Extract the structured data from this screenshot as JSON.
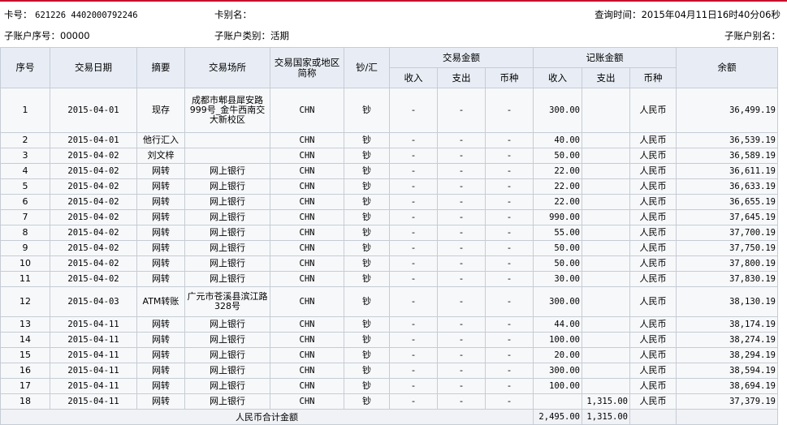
{
  "header": {
    "card_no_label": "卡号：",
    "card_no": "621226 4402000792246",
    "card_alias_label": "卡别名：",
    "query_time_label": "查询时间：",
    "query_time": "2015年04月11日16时40分06秒",
    "sub_seq_label": "子账户序号：",
    "sub_seq": "00000",
    "sub_type_label": "子账户类别：",
    "sub_type": "活期",
    "sub_alias_label": "子账户别名："
  },
  "table": {
    "headers": {
      "seq": "序号",
      "date": "交易日期",
      "summary": "摘要",
      "place": "交易场所",
      "country": "交易国家或地区简称",
      "cash": "钞/汇",
      "trans_amount": "交易金额",
      "book_amount": "记账金额",
      "balance": "余额",
      "income": "收入",
      "expense": "支出",
      "currency": "币种"
    },
    "rows": [
      {
        "seq": "1",
        "date": "2015-04-01",
        "summary": "现存",
        "place": "成都市郫县犀安路999号_金牛西南交大新校区",
        "country": "CHN",
        "cash": "钞",
        "t_in": "-",
        "t_out": "-",
        "t_cur": "-",
        "b_in": "300.00",
        "b_out": "",
        "b_cur": "人民币",
        "balance": "36,499.19"
      },
      {
        "seq": "2",
        "date": "2015-04-01",
        "summary": "他行汇入",
        "place": "",
        "country": "CHN",
        "cash": "钞",
        "t_in": "-",
        "t_out": "-",
        "t_cur": "-",
        "b_in": "40.00",
        "b_out": "",
        "b_cur": "人民币",
        "balance": "36,539.19"
      },
      {
        "seq": "3",
        "date": "2015-04-02",
        "summary": "刘文梓",
        "place": "",
        "country": "CHN",
        "cash": "钞",
        "t_in": "-",
        "t_out": "-",
        "t_cur": "-",
        "b_in": "50.00",
        "b_out": "",
        "b_cur": "人民币",
        "balance": "36,589.19"
      },
      {
        "seq": "4",
        "date": "2015-04-02",
        "summary": "网转",
        "place": "网上银行",
        "country": "CHN",
        "cash": "钞",
        "t_in": "-",
        "t_out": "-",
        "t_cur": "-",
        "b_in": "22.00",
        "b_out": "",
        "b_cur": "人民币",
        "balance": "36,611.19"
      },
      {
        "seq": "5",
        "date": "2015-04-02",
        "summary": "网转",
        "place": "网上银行",
        "country": "CHN",
        "cash": "钞",
        "t_in": "-",
        "t_out": "-",
        "t_cur": "-",
        "b_in": "22.00",
        "b_out": "",
        "b_cur": "人民币",
        "balance": "36,633.19"
      },
      {
        "seq": "6",
        "date": "2015-04-02",
        "summary": "网转",
        "place": "网上银行",
        "country": "CHN",
        "cash": "钞",
        "t_in": "-",
        "t_out": "-",
        "t_cur": "-",
        "b_in": "22.00",
        "b_out": "",
        "b_cur": "人民币",
        "balance": "36,655.19"
      },
      {
        "seq": "7",
        "date": "2015-04-02",
        "summary": "网转",
        "place": "网上银行",
        "country": "CHN",
        "cash": "钞",
        "t_in": "-",
        "t_out": "-",
        "t_cur": "-",
        "b_in": "990.00",
        "b_out": "",
        "b_cur": "人民币",
        "balance": "37,645.19"
      },
      {
        "seq": "8",
        "date": "2015-04-02",
        "summary": "网转",
        "place": "网上银行",
        "country": "CHN",
        "cash": "钞",
        "t_in": "-",
        "t_out": "-",
        "t_cur": "-",
        "b_in": "55.00",
        "b_out": "",
        "b_cur": "人民币",
        "balance": "37,700.19"
      },
      {
        "seq": "9",
        "date": "2015-04-02",
        "summary": "网转",
        "place": "网上银行",
        "country": "CHN",
        "cash": "钞",
        "t_in": "-",
        "t_out": "-",
        "t_cur": "-",
        "b_in": "50.00",
        "b_out": "",
        "b_cur": "人民币",
        "balance": "37,750.19"
      },
      {
        "seq": "10",
        "date": "2015-04-02",
        "summary": "网转",
        "place": "网上银行",
        "country": "CHN",
        "cash": "钞",
        "t_in": "-",
        "t_out": "-",
        "t_cur": "-",
        "b_in": "50.00",
        "b_out": "",
        "b_cur": "人民币",
        "balance": "37,800.19"
      },
      {
        "seq": "11",
        "date": "2015-04-02",
        "summary": "网转",
        "place": "网上银行",
        "country": "CHN",
        "cash": "钞",
        "t_in": "-",
        "t_out": "-",
        "t_cur": "-",
        "b_in": "30.00",
        "b_out": "",
        "b_cur": "人民币",
        "balance": "37,830.19"
      },
      {
        "seq": "12",
        "date": "2015-04-03",
        "summary": "ATM转账",
        "place": "广元市苍溪县滨江路328号",
        "country": "CHN",
        "cash": "钞",
        "t_in": "-",
        "t_out": "-",
        "t_cur": "-",
        "b_in": "300.00",
        "b_out": "",
        "b_cur": "人民币",
        "balance": "38,130.19"
      },
      {
        "seq": "13",
        "date": "2015-04-11",
        "summary": "网转",
        "place": "网上银行",
        "country": "CHN",
        "cash": "钞",
        "t_in": "-",
        "t_out": "-",
        "t_cur": "-",
        "b_in": "44.00",
        "b_out": "",
        "b_cur": "人民币",
        "balance": "38,174.19"
      },
      {
        "seq": "14",
        "date": "2015-04-11",
        "summary": "网转",
        "place": "网上银行",
        "country": "CHN",
        "cash": "钞",
        "t_in": "-",
        "t_out": "-",
        "t_cur": "-",
        "b_in": "100.00",
        "b_out": "",
        "b_cur": "人民币",
        "balance": "38,274.19"
      },
      {
        "seq": "15",
        "date": "2015-04-11",
        "summary": "网转",
        "place": "网上银行",
        "country": "CHN",
        "cash": "钞",
        "t_in": "-",
        "t_out": "-",
        "t_cur": "-",
        "b_in": "20.00",
        "b_out": "",
        "b_cur": "人民币",
        "balance": "38,294.19"
      },
      {
        "seq": "16",
        "date": "2015-04-11",
        "summary": "网转",
        "place": "网上银行",
        "country": "CHN",
        "cash": "钞",
        "t_in": "-",
        "t_out": "-",
        "t_cur": "-",
        "b_in": "300.00",
        "b_out": "",
        "b_cur": "人民币",
        "balance": "38,594.19"
      },
      {
        "seq": "17",
        "date": "2015-04-11",
        "summary": "网转",
        "place": "网上银行",
        "country": "CHN",
        "cash": "钞",
        "t_in": "-",
        "t_out": "-",
        "t_cur": "-",
        "b_in": "100.00",
        "b_out": "",
        "b_cur": "人民币",
        "balance": "38,694.19"
      },
      {
        "seq": "18",
        "date": "2015-04-11",
        "summary": "网转",
        "place": "网上银行",
        "country": "CHN",
        "cash": "钞",
        "t_in": "-",
        "t_out": "-",
        "t_cur": "-",
        "b_in": "",
        "b_out": "1,315.00",
        "b_cur": "人民币",
        "balance": "37,379.19"
      }
    ],
    "footer": {
      "label": "人民币合计金额",
      "total_in": "2,495.00",
      "total_out": "1,315.00"
    }
  }
}
